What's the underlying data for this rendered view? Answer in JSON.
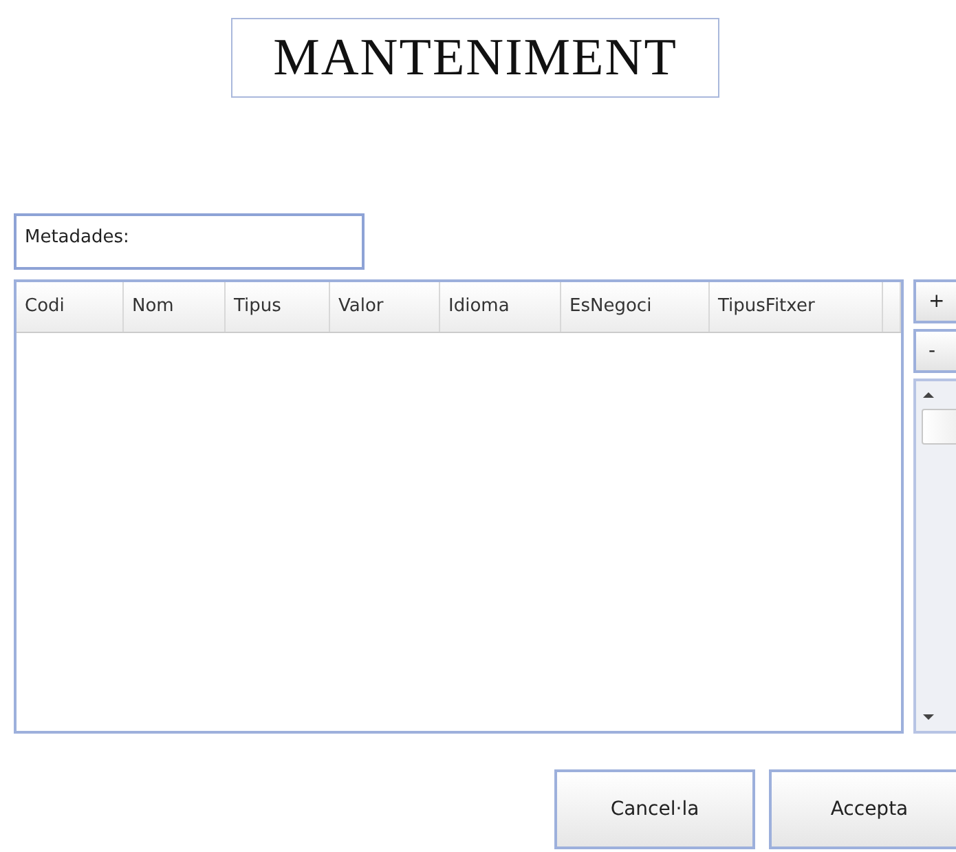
{
  "title": "MANTENIMENT",
  "metadata_label": "Metadades:",
  "table": {
    "columns": [
      "Codi",
      "Nom",
      "Tipus",
      "Valor",
      "Idioma",
      "EsNegoci",
      "TipusFitxer"
    ]
  },
  "side_buttons": [
    "+",
    "-"
  ],
  "buttons": [
    "Cancel·la",
    "Accepta"
  ]
}
